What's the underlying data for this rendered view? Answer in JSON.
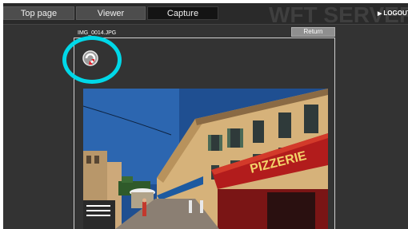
{
  "tabs": [
    {
      "label": "Top page",
      "active": false
    },
    {
      "label": "Viewer",
      "active": false
    },
    {
      "label": "Capture",
      "active": true
    }
  ],
  "brand": {
    "text": "WFT SERVER"
  },
  "logout": {
    "arrow": "▶",
    "label": "LOGOUT"
  },
  "file": {
    "name": "IMG_0014.JPG"
  },
  "return_button": {
    "label": "Return"
  },
  "icons": {
    "capture": "camera-capture-icon"
  },
  "colors": {
    "background": "#333333",
    "active_tab": "#141414",
    "tab": "#4d4d4d",
    "highlight": "#00d8e8",
    "capture_icon_accent": "#e0202a"
  },
  "photo": {
    "sign_text": "PIZZERIE"
  }
}
